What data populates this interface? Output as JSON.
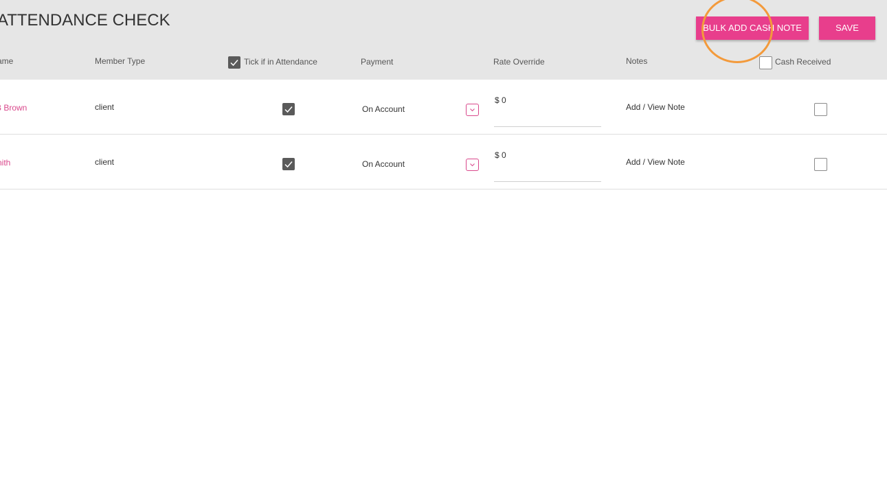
{
  "colors": {
    "accent": "#e83e8c",
    "highlight_ring": "#f39a3b",
    "header_bg": "#e6e6e6",
    "link": "#d9478b"
  },
  "header": {
    "title": "ATTENDANCE CHECK",
    "bulk_button_label": "BULK ADD CASH NOTE",
    "save_button_label": "SAVE"
  },
  "columns": {
    "name": "ame",
    "member_type": "Member Type",
    "attendance": "Tick if in Attendance",
    "payment": "Payment",
    "rate_override": "Rate Override",
    "notes": "Notes",
    "cash_received": "Cash Received"
  },
  "header_checks": {
    "attendance_all": true,
    "cash_all": false
  },
  "rows": [
    {
      "name": "B Brown",
      "member_type": "client",
      "attended": true,
      "payment": "On Account",
      "rate": "$ 0",
      "notes_link": "Add / View Note",
      "cash_received": false
    },
    {
      "name": "nith",
      "member_type": "client",
      "attended": true,
      "payment": "On Account",
      "rate": "$ 0",
      "notes_link": "Add / View Note",
      "cash_received": false
    }
  ],
  "icons": {
    "check": "checkmark-icon",
    "dropdown": "chevron-down-icon"
  }
}
